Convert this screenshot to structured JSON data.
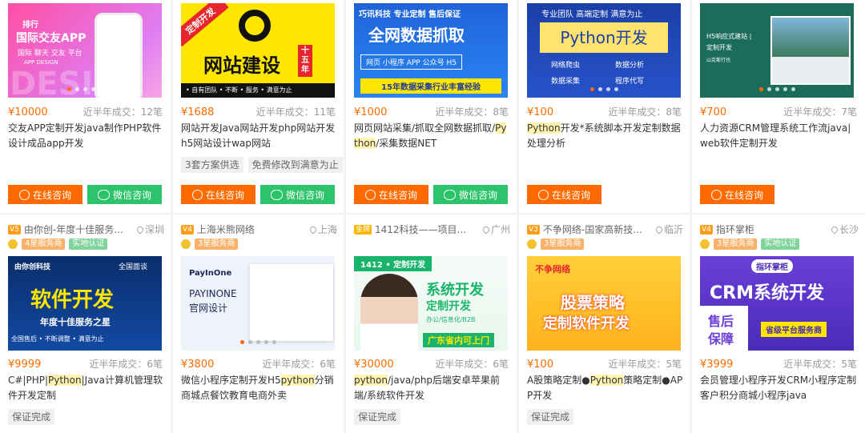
{
  "common": {
    "deal_prefix": "近半年成交：",
    "consult_label": "在线咨询",
    "wechat_label": "微信咨询"
  },
  "row1": [
    {
      "price": "¥10000",
      "deals": "近半年成交：12笔",
      "title_parts": [
        "交友APP定制开发java制作PHP软件设计成品app开发"
      ],
      "thumb": {
        "line1": "排行",
        "line2": "国际交友APP",
        "line3": "国际 聊天 交友 平台",
        "line4": "APP DESIGN",
        "big": "DESI"
      },
      "tags": [],
      "buttons": [
        "consult",
        "wechat"
      ]
    },
    {
      "price": "¥1688",
      "deals": "近半年成交：11笔",
      "title_parts": [
        "网站开发Java网站开发php网站开发h5网站设计wap网站"
      ],
      "thumb": {
        "ribbon": "定制开发",
        "main": "网站建设",
        "stamp": "十五年",
        "bottom": "• 自有团队    • 不断 • 服务    • 满意为止"
      },
      "tags": [
        "3套方案供选",
        "免费修改到满意为止"
      ],
      "buttons": [
        "consult",
        "wechat"
      ]
    },
    {
      "price": "¥1000",
      "deals": "近半年成交：8笔",
      "title_parts": [
        "网页网站采集/抓取全网数据抓取/",
        "Python",
        "/采集数据NET"
      ],
      "thumb": {
        "top": "巧讯科技  专业定制  售后保证",
        "main": "全网数据抓取",
        "mid": "网页  小程序  APP  公众号  H5",
        "bottom": "15年数据采集行业丰富经验"
      },
      "tags": [],
      "buttons": [
        "consult",
        "wechat"
      ]
    },
    {
      "price": "¥100",
      "deals": "近半年成交：8笔",
      "title_parts": [
        "Python",
        "开发*系统脚本开发定制数据处理分析"
      ],
      "thumb": {
        "top": "专业团队  高端定制  满意为止",
        "main": "Python开发",
        "f1": "网络爬虫",
        "f2": "数据分析",
        "f3": "数据采集",
        "f4": "程序代写"
      },
      "tags": [],
      "buttons": [
        "consult"
      ]
    },
    {
      "price": "¥700",
      "deals": "近半年成交：7笔",
      "title_parts": [
        "人力资源CRM管理系统工作流java|web软件定制开发"
      ],
      "thumb": {
        "line1": "H5响应式建站 |",
        "line2": "定制开发",
        "line3": "山克斯行也"
      },
      "tags": [],
      "buttons": [
        "consult"
      ]
    }
  ],
  "row2": [
    {
      "shop": "由你创-年度十佳服务...",
      "level": "V5",
      "city": "深圳",
      "badges": [
        "4星服务商",
        "实地认证"
      ],
      "price": "¥9999",
      "deals": "近半年成交：6笔",
      "title_parts": [
        "C#|PHP|",
        "Python",
        "|Java计算机管理软件开发定制"
      ],
      "thumb": {
        "brand": "由你创科技",
        "corner": "全国面谈",
        "main": "软件开发",
        "sub": "年度十佳服务之星",
        "bottom": "全国售后 • 不断调整 • 满意为止"
      },
      "tags": [
        "保证完成"
      ]
    },
    {
      "shop": "上海米熊网络",
      "level": "V4",
      "city": "上海",
      "badges": [
        "3星服务商"
      ],
      "price": "¥3800",
      "deals": "近半年成交：6笔",
      "title_parts": [
        "微信小程序定制开发H5",
        "python",
        "分销商城点餐饮教育电商外卖"
      ],
      "thumb": {
        "brand": "PayInOne",
        "t1": "PAYINONE",
        "t2": "官网设计"
      },
      "tags": []
    },
    {
      "shop": "1412科技——项目...",
      "level": "金牌",
      "city": "广州",
      "badges": [],
      "price": "¥30000",
      "deals": "近半年成交：6笔",
      "title_parts": [
        "python",
        "/java/php后端安卓苹果前端/系统软件开发"
      ],
      "thumb": {
        "ribbon": "1412 • 定制开发",
        "main1": "系统开发",
        "main2": "定制开发",
        "sub": "办公/信息化/B2B",
        "bottom": "广东省内可上门"
      },
      "tags": [
        "保证完成"
      ]
    },
    {
      "shop": "不争网络-国家高新技...",
      "level": "V3",
      "city": "临沂",
      "badges": [
        "3星服务商"
      ],
      "price": "¥100",
      "deals": "近半年成交：5笔",
      "title_parts": [
        "A股策略定制●",
        "Python",
        "策略定制●APP开发"
      ],
      "thumb": {
        "brand": "不争网络",
        "main1": "股票策略",
        "main2": "定制软件开发"
      },
      "tags": [
        "保证完成"
      ]
    },
    {
      "shop": "指环掌柜",
      "level": "V4",
      "city": "长沙",
      "badges": [
        "3星服务商",
        "实地认证"
      ],
      "price": "¥3999",
      "deals": "近半年成交：5笔",
      "title_parts": [
        "会员管理小程序开发CRM小程序定制客户积分商城小程序java"
      ],
      "thumb": {
        "brand": "指环掌柜",
        "main": "CRM系统开发",
        "left1": "售后",
        "left2": "保障",
        "right": "省级平台服务商"
      },
      "tags": []
    }
  ],
  "colors": {
    "accent": "#ff6a00",
    "wechat": "#2cc36b",
    "highlight": "#fff3b0"
  }
}
